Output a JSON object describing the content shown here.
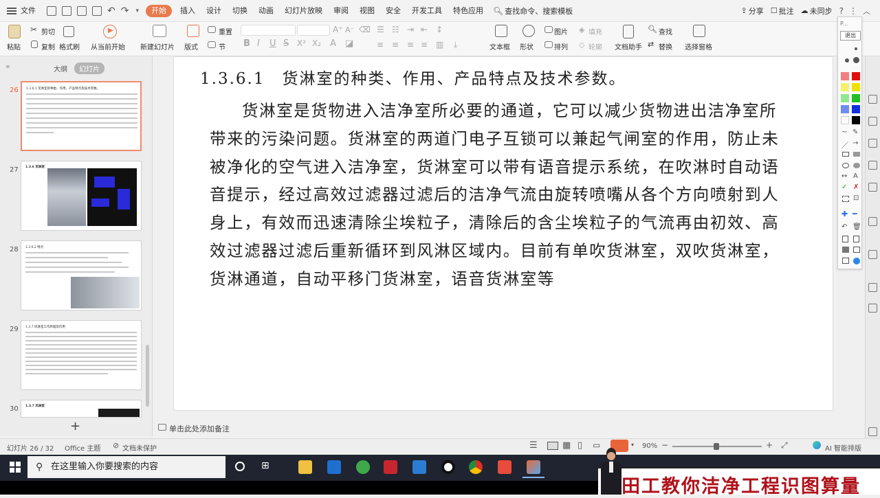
{
  "menubar": {
    "file_label": "文件",
    "tabs": [
      "开始",
      "插入",
      "设计",
      "切换",
      "动画",
      "幻灯片放映",
      "审阅",
      "视图",
      "安全",
      "开发工具",
      "特色应用"
    ],
    "search_label": "查找命令、搜索模板",
    "share_label": "分享",
    "comment_label": "批注",
    "sync_label": "未同步"
  },
  "ribbon": {
    "paste": "粘贴",
    "cut": "剪切",
    "copy": "复制",
    "format_painter": "格式刷",
    "from_current": "从当前开始",
    "new_slide": "新建幻灯片",
    "layout": "版式",
    "section": "节",
    "reset": "重置",
    "textbox": "文本框",
    "shape": "形状",
    "arrange": "排列",
    "picture": "图片",
    "fill": "填充",
    "outline": "轮廓",
    "doc_assistant": "文档助手",
    "find": "查找",
    "replace": "替换",
    "select_pane": "选择窗格"
  },
  "leftpanel": {
    "tab_outline": "大纲",
    "tab_slides": "幻灯片",
    "slides": [
      {
        "num": "26",
        "title": "1.3.6.1 货淋室的种类、作用、产品特点及技术参数。"
      },
      {
        "num": "27",
        "title": "1.3.6 货淋室"
      },
      {
        "num": "28",
        "title": "1.3.6.2 特点"
      },
      {
        "num": "29",
        "title": "1.3.7 风淋室工作原理及作用"
      },
      {
        "num": "30",
        "title": "1.3.7 风淋室"
      }
    ],
    "add_label": "+"
  },
  "slide": {
    "heading": "1.3.6.1　货淋室的种类、作用、产品特点及技术参数。",
    "body": "货淋室是货物进入洁净室所必要的通道，它可以减少货物进出洁净室所带来的污染问题。货淋室的两道门电子互锁可以兼起气闸室的作用，防止未被净化的空气进入洁净室，货淋室可以带有语音提示系统，在吹淋时自动语音提示，经过高效过滤器过滤后的洁净气流由旋转喷嘴从各个方向喷射到人身上，有效而迅速清除尘埃粒子，清除后的含尘埃粒子的气流再由初效、高效过滤器过滤后重新循环到风淋区域内。目前有单吹货淋室，双吹货淋室，货淋通道，自动平移门货淋室，语音货淋室等"
  },
  "notes": {
    "placeholder": "单击此处添加备注"
  },
  "statusbar": {
    "slide_count": "幻灯片 26 / 32",
    "theme": "Office 主题",
    "protect": "文档未保护",
    "zoom": "90%",
    "ai_label": "AI 智能排版"
  },
  "pentool": {
    "top_label": "P...",
    "exit_label": "退出"
  },
  "taskbar": {
    "search_placeholder": "在这里输入你要搜索的内容"
  },
  "caption": {
    "text": "田工教你洁净工程识图算量"
  },
  "colors": {
    "accent": "#e87a4e",
    "caption_red": "#b0121b",
    "selected_border": "#f08a6a"
  }
}
